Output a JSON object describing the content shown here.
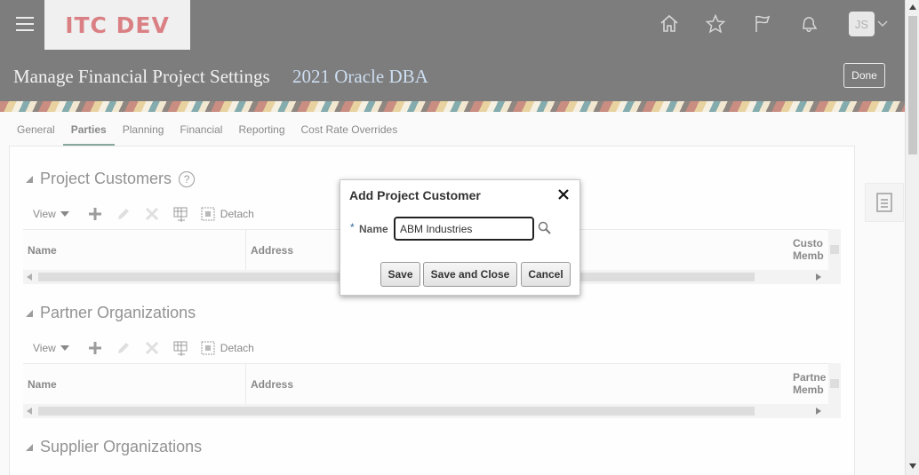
{
  "header": {
    "logo_text": "ITC DEV",
    "avatar_initials": "JS",
    "icons": [
      "home-icon",
      "star-icon",
      "flag-icon",
      "bell-icon"
    ]
  },
  "titlebar": {
    "title": "Manage Financial Project Settings",
    "subtitle": "2021 Oracle DBA",
    "done_label": "Done"
  },
  "tabs": [
    {
      "label": "General",
      "active": false
    },
    {
      "label": "Parties",
      "active": true
    },
    {
      "label": "Planning",
      "active": false
    },
    {
      "label": "Financial",
      "active": false
    },
    {
      "label": "Reporting",
      "active": false
    },
    {
      "label": "Cost Rate Overrides",
      "active": false
    }
  ],
  "sections": [
    {
      "title": "Project Customers",
      "toolbar": {
        "view": "View",
        "detach": "Detach"
      },
      "columns": {
        "name": "Name",
        "address": "Address",
        "right": "Custo Memb"
      }
    },
    {
      "title": "Partner Organizations",
      "toolbar": {
        "view": "View",
        "detach": "Detach"
      },
      "columns": {
        "name": "Name",
        "address": "Address",
        "right": "Partne Memb"
      }
    },
    {
      "title": "Supplier Organizations"
    }
  ],
  "dialog": {
    "title": "Add Project Customer",
    "required_mark": "*",
    "name_label": "Name",
    "name_value": "ABM Industries",
    "save_label": "Save",
    "save_close_label": "Save and Close",
    "cancel_label": "Cancel"
  },
  "colors": {
    "header_bg": "#221f1f",
    "logo_red": "#c0252b",
    "subtitle_blue": "#a8c6e8",
    "active_tab": "#336a55"
  }
}
